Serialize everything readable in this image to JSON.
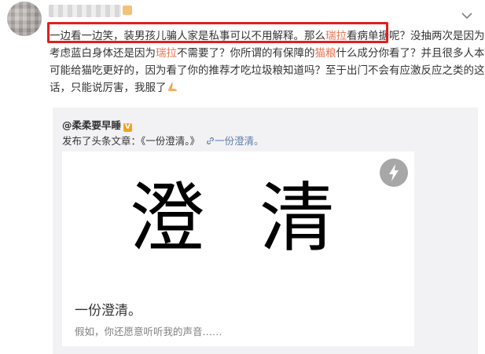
{
  "post": {
    "lines": [
      [
        "一边看一边笑，装男孩儿骗人家是私事可以不用解释。那么",
        "瑞拉",
        "看病单据呢？",
        "没抽两次是因为"
      ],
      [
        "考虑蓝白身体还是因为",
        "瑞拉",
        "不需要了？你所谓的有保障的",
        "猫粮",
        "什么成分你看了？并且很多人本来"
      ],
      [
        "可能给猫吃更好的，因为看了你的推荐才吃垃圾粮知道吗？至于出门不会有应激反应之类的这种"
      ],
      [
        "话，只能说厉害，我服了"
      ]
    ],
    "emoji": "pray-hands-emoji"
  },
  "repost": {
    "author": "@柔柔要早睡",
    "badge": "V",
    "article_prefix": "发布了头条文章：《一份澄清。》",
    "article_link": "一份澄清。",
    "card": {
      "big_title": "澄清",
      "title": "一份澄清。",
      "desc": "假如，你还愿意听听我的声音……"
    }
  },
  "icons": {
    "menu": "chevron-down-icon",
    "link": "link-icon",
    "flash": "lightning-icon"
  },
  "colors": {
    "highlight": "#eb7350",
    "link": "#5d7ca8",
    "annotation_box": "#e02020",
    "repost_bg": "#f2f2f5"
  }
}
